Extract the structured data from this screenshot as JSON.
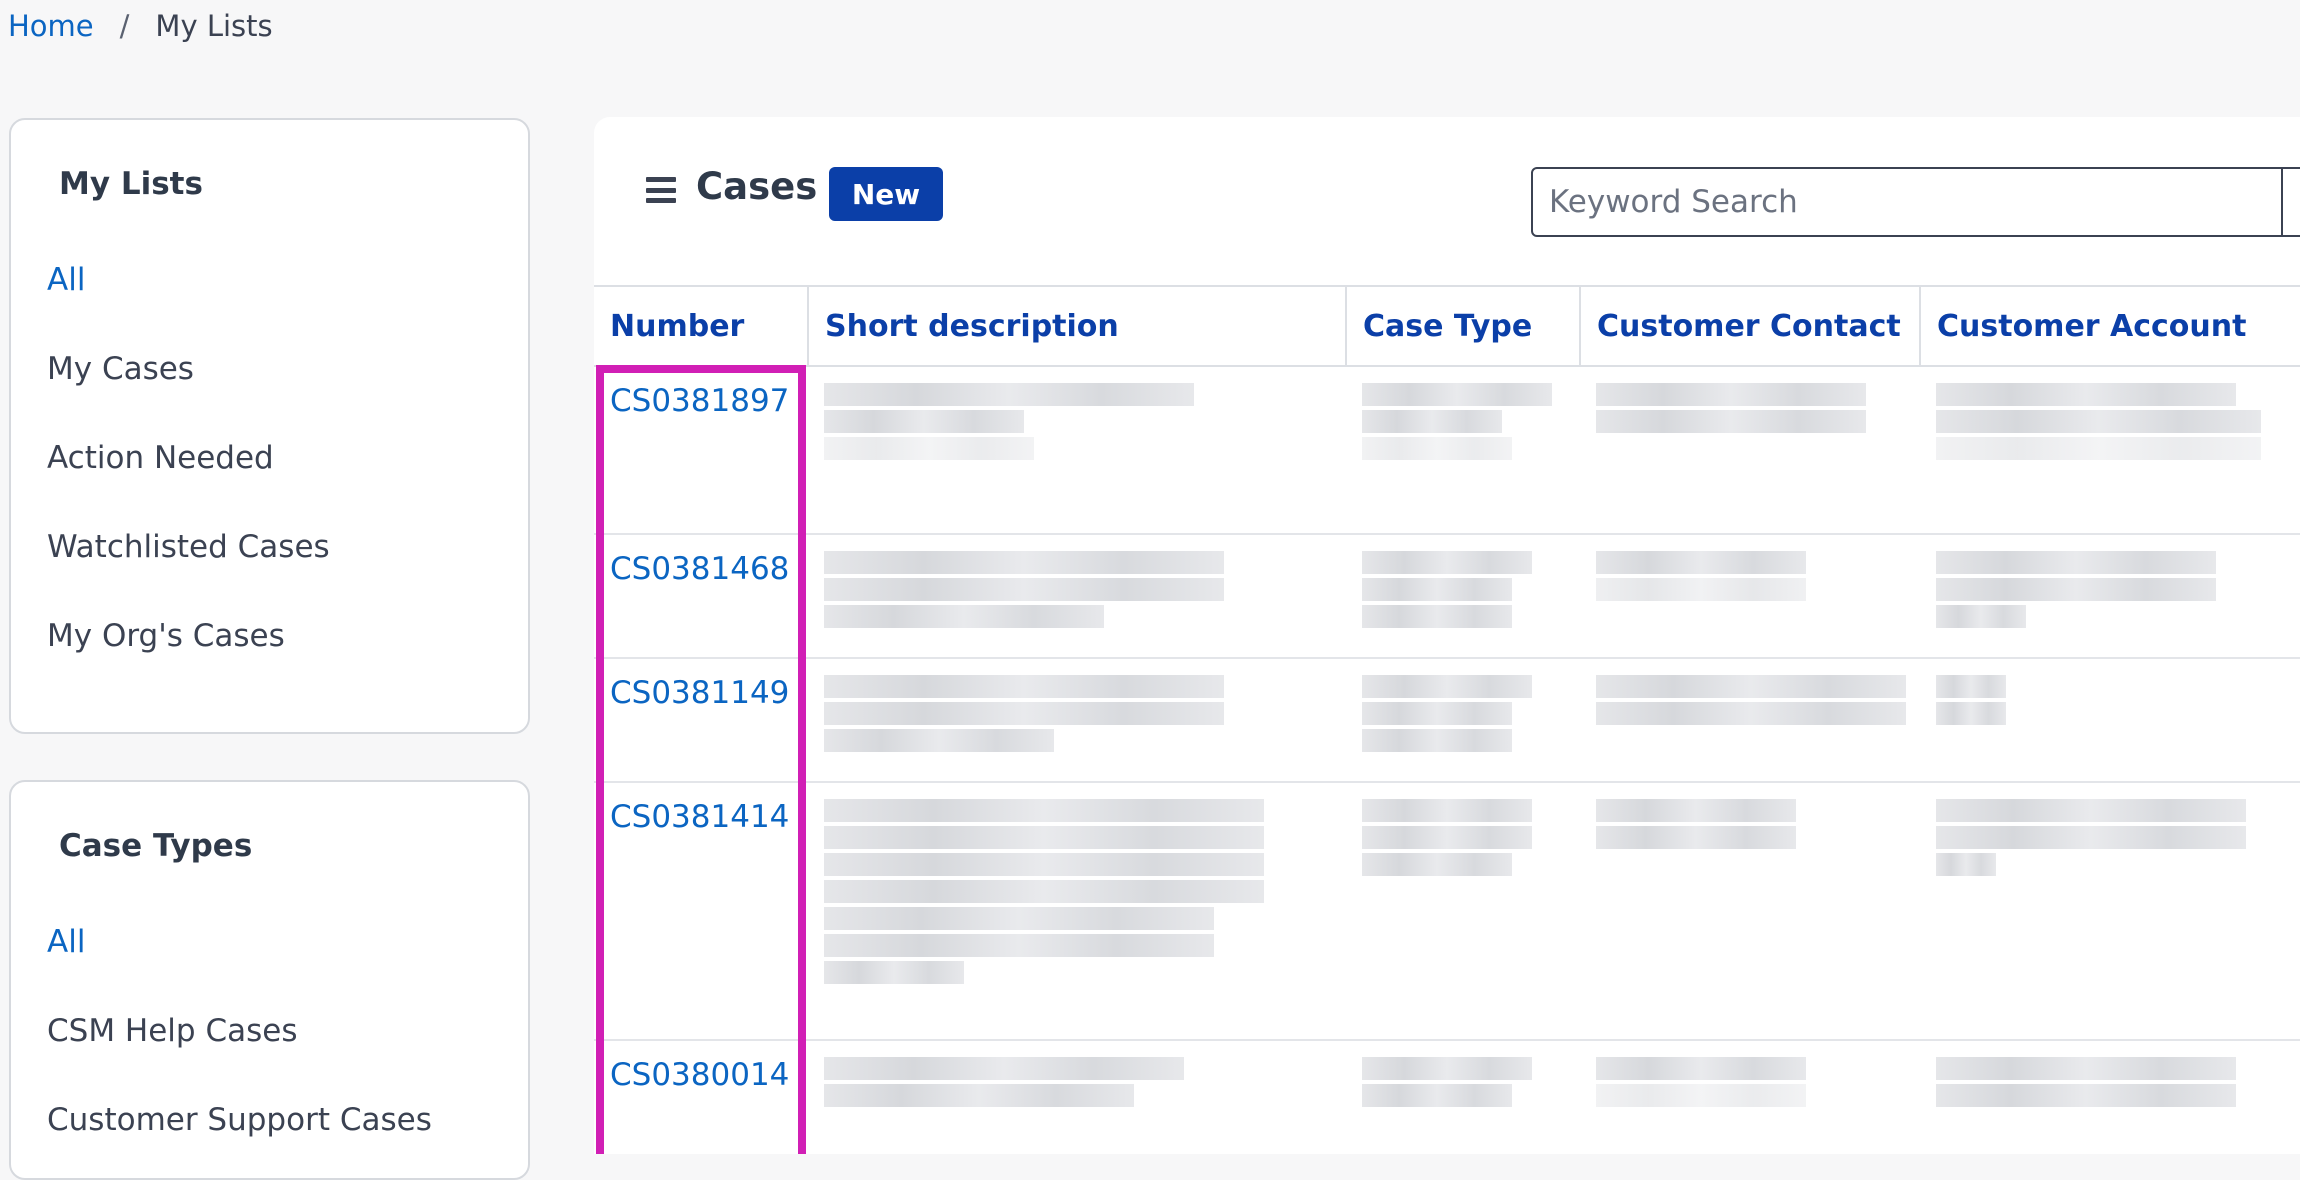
{
  "breadcrumb": {
    "home": "Home",
    "separator": "/",
    "current": "My Lists"
  },
  "my_lists": {
    "title": "My Lists",
    "items": [
      "All",
      "My Cases",
      "Action Needed",
      "Watchlisted Cases",
      "My Org's Cases"
    ]
  },
  "case_types": {
    "title": "Case Types",
    "items": [
      "All",
      "CSM Help Cases",
      "Customer Support Cases"
    ]
  },
  "header": {
    "title": "Cases",
    "new_label": "New",
    "search_placeholder": "Keyword Search",
    "menu_icon": "hamburger-menu-icon",
    "search_icon": "search-icon"
  },
  "table": {
    "columns": [
      "Number",
      "Short description",
      "Case Type",
      "Customer Contact",
      "Customer Account"
    ],
    "rows": [
      {
        "number": "CS0381897"
      },
      {
        "number": "CS0381468"
      },
      {
        "number": "CS0381149"
      },
      {
        "number": "CS0381414"
      },
      {
        "number": "CS0380014"
      }
    ]
  },
  "colors": {
    "accent": "#0b65c2",
    "brand": "#0b3fa8",
    "highlight": "#d11fb5"
  }
}
